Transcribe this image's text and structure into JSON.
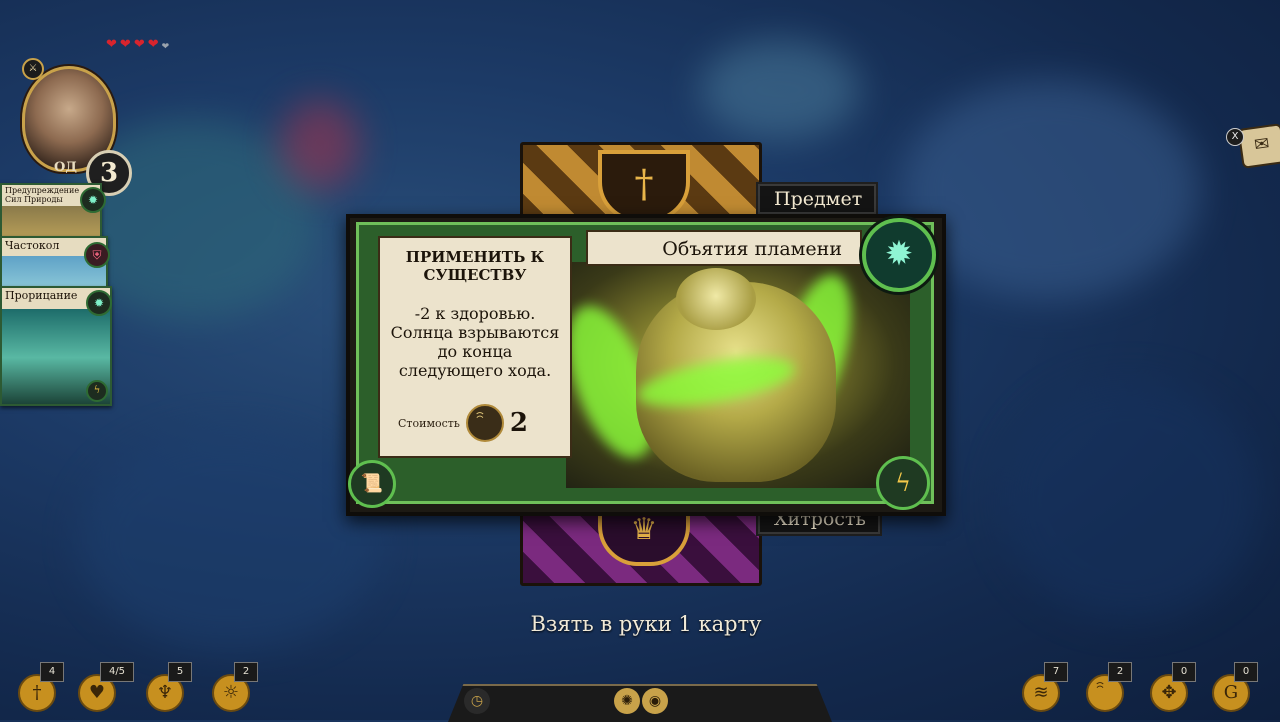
{
  "hero": {
    "hearts_filled": 4,
    "hearts_total": 5,
    "heart_glyph": "❤",
    "ap_label": "ОД",
    "ap_value": "3"
  },
  "hand": [
    {
      "title": "Предупреждение Сил Природы"
    },
    {
      "title": "Частокол"
    },
    {
      "title": "Прорицание"
    }
  ],
  "tabs": {
    "item": "Предмет",
    "craft": "Хитрость"
  },
  "card": {
    "name": "Объятия пламени",
    "heading": "ПРИМЕНИТЬ К СУЩЕСТВУ",
    "body": "-2 к здоровью. Солнца взрываются до конца следующего хода.",
    "cost_label": "Стоимость",
    "cost_value": "2",
    "type_icon": "sun-icon",
    "accent_color": "#5fbf4f"
  },
  "action_text": "Взять в руки 1 карту",
  "quest": {
    "key": "X",
    "icon": "scroll-icon"
  },
  "stats_left": [
    {
      "icon": "sword-icon",
      "count": "4"
    },
    {
      "icon": "heart-icon",
      "count": "4/5"
    },
    {
      "icon": "chalice-icon",
      "count": "5"
    },
    {
      "icon": "flame-icon",
      "count": "2"
    }
  ],
  "stats_right": [
    {
      "icon": "wind-icon",
      "count": "7"
    },
    {
      "icon": "swirl-icon",
      "count": "2"
    },
    {
      "icon": "paw-icon",
      "count": "0"
    },
    {
      "icon": "g-coin-icon",
      "count": "0"
    }
  ]
}
